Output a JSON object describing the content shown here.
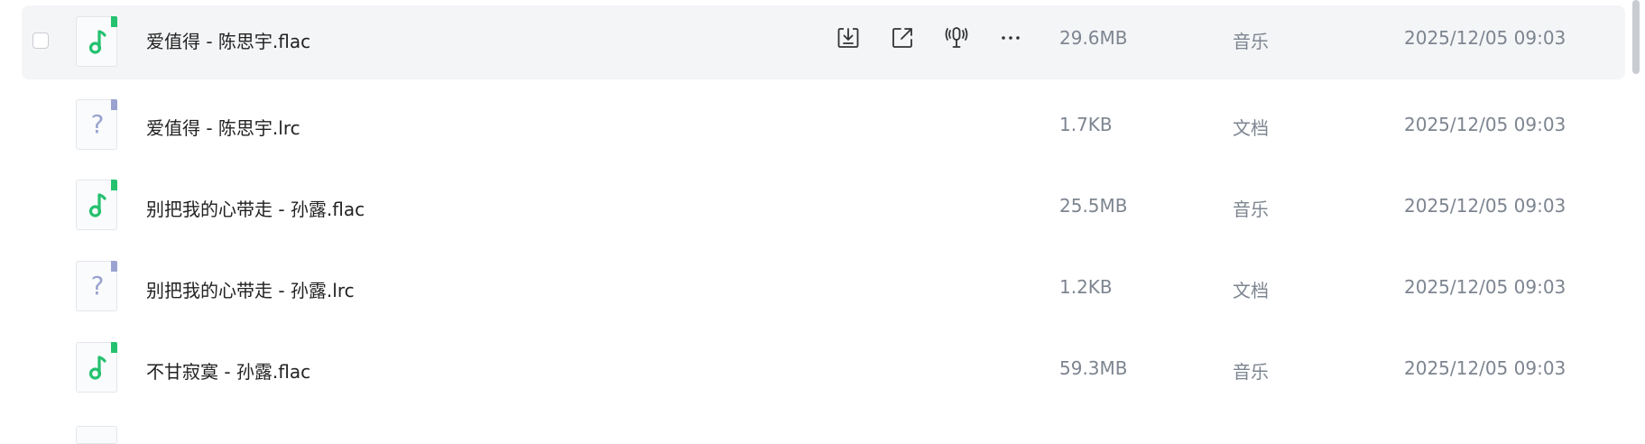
{
  "colors": {
    "music_accent": "#24c16f",
    "doc_accent": "#9aa3cf",
    "row_hover_bg": "#f4f5f7",
    "meta_text": "#7d8590"
  },
  "row_actions": [
    {
      "icon": "download-icon"
    },
    {
      "icon": "share-icon"
    },
    {
      "icon": "podcast-mic-icon"
    },
    {
      "icon": "more-icon"
    }
  ],
  "files": [
    {
      "name": "爱值得 - 陈思宇.flac",
      "size": "29.6MB",
      "type": "音乐",
      "date": "2025/12/05 09:03",
      "icon": "music-file-icon",
      "hovered": true
    },
    {
      "name": "爱值得 - 陈思宇.lrc",
      "size": "1.7KB",
      "type": "文档",
      "date": "2025/12/05 09:03",
      "icon": "unknown-file-icon",
      "hovered": false
    },
    {
      "name": "别把我的心带走 - 孙露.flac",
      "size": "25.5MB",
      "type": "音乐",
      "date": "2025/12/05 09:03",
      "icon": "music-file-icon",
      "hovered": false
    },
    {
      "name": "别把我的心带走 - 孙露.lrc",
      "size": "1.2KB",
      "type": "文档",
      "date": "2025/12/05 09:03",
      "icon": "unknown-file-icon",
      "hovered": false
    },
    {
      "name": "不甘寂寞 - 孙露.flac",
      "size": "59.3MB",
      "type": "音乐",
      "date": "2025/12/05 09:03",
      "icon": "music-file-icon",
      "hovered": false
    }
  ]
}
